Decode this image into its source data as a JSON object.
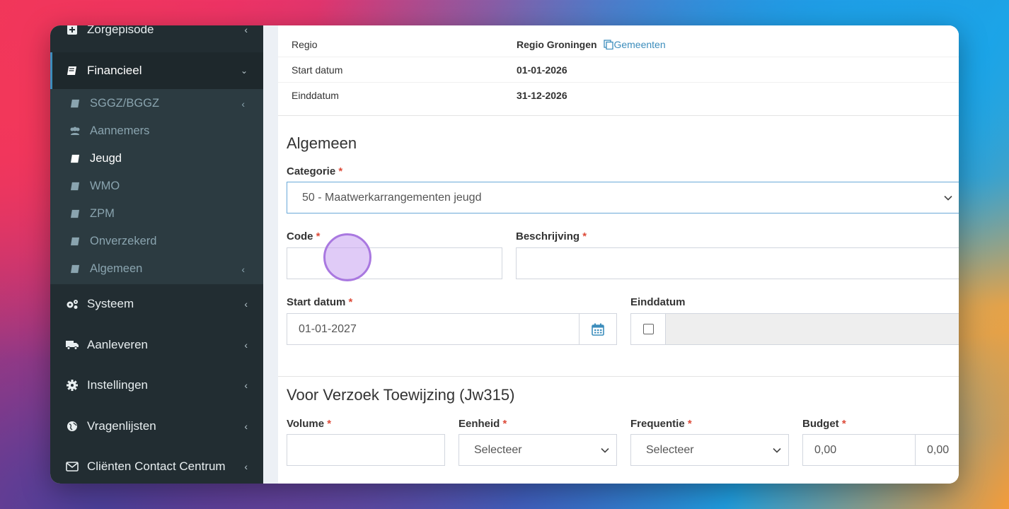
{
  "sidebar": {
    "top_item": {
      "label": "Zorgepisode",
      "icon": "plus-square-icon"
    },
    "financieel": {
      "label": "Financieel",
      "icon": "book-icon"
    },
    "sub_items": [
      {
        "label": "SGGZ/BGGZ",
        "icon": "book-icon",
        "has_children": true
      },
      {
        "label": "Aannemers",
        "icon": "users-icon",
        "has_children": false
      },
      {
        "label": "Jeugd",
        "icon": "book-icon",
        "has_children": false,
        "active": true
      },
      {
        "label": "WMO",
        "icon": "book-icon",
        "has_children": false
      },
      {
        "label": "ZPM",
        "icon": "book-icon",
        "has_children": false
      },
      {
        "label": "Onverzekerd",
        "icon": "book-icon",
        "has_children": false
      },
      {
        "label": "Algemeen",
        "icon": "book-icon",
        "has_children": true
      }
    ],
    "items": [
      {
        "label": "Systeem",
        "icon": "cogs-icon"
      },
      {
        "label": "Aanleveren",
        "icon": "truck-icon"
      },
      {
        "label": "Instellingen",
        "icon": "gear-icon"
      },
      {
        "label": "Vragenlijsten",
        "icon": "globe-icon"
      },
      {
        "label": "Cliënten Contact Centrum",
        "icon": "envelope-icon"
      }
    ]
  },
  "info": {
    "regio_label": "Regio",
    "regio_value": "Regio Groningen",
    "gemeenten_link": "Gemeenten",
    "start_label": "Start datum",
    "start_value": "01-01-2026",
    "eind_label": "Einddatum",
    "eind_value": "31-12-2026"
  },
  "algemeen": {
    "title": "Algemeen",
    "categorie_label": "Categorie",
    "categorie_value": "50 - Maatwerkarrangementen jeugd",
    "code_label": "Code",
    "code_value": "",
    "beschrijving_label": "Beschrijving",
    "beschrijving_value": "",
    "start_label": "Start datum",
    "start_value": "01-01-2027",
    "eind_label": "Einddatum",
    "required_marker": "*"
  },
  "vvt": {
    "title": "Voor Verzoek Toewijzing (Jw315)",
    "volume_label": "Volume",
    "eenheid_label": "Eenheid",
    "eenheid_value": "Selecteer",
    "frequentie_label": "Frequentie",
    "frequentie_value": "Selecteer",
    "budget_label": "Budget",
    "budget_value": "0,00",
    "budget_value2": "0,00"
  },
  "colors": {
    "sidebar_bg": "#222d32",
    "accent": "#3c8dbc",
    "required": "#dd4b39"
  }
}
